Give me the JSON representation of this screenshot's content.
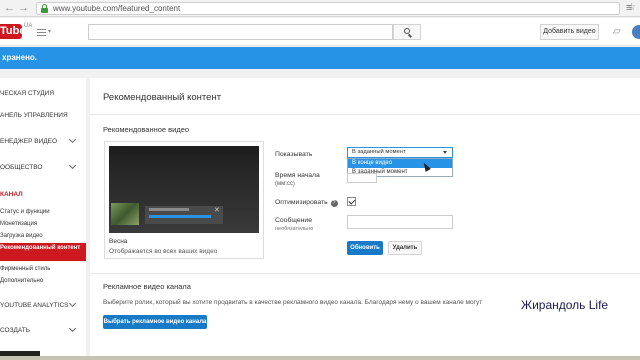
{
  "browser": {
    "url": "www.youtube.com/featured_content",
    "back_arrow": "←",
    "forward_arrow": "→",
    "star_glyph": "☆",
    "menu_glyph": "≡"
  },
  "masthead": {
    "logo_text": "Tube",
    "logo_region": "UA",
    "search_placeholder": "",
    "upload_label": "Добавить видео",
    "bell_glyph": "🔔",
    "brand_color": "#cc181e"
  },
  "banner": {
    "text": "хранено.",
    "color": "#2793e6"
  },
  "sidebar": {
    "items": [
      {
        "label": "ЧЕСКАЯ СТУДИЯ",
        "chevron": false
      },
      {
        "label": "АНЕЛЬ УПРАВЛЕНИЯ",
        "chevron": false
      },
      {
        "label": "ЕНЕДЖЕР ВИДЕО",
        "chevron": true
      },
      {
        "label": "ООБЩЕСТВО",
        "chevron": true
      }
    ],
    "section_label": "КАНАЛ",
    "sub_items": [
      {
        "label": "Статус и функции"
      },
      {
        "label": "Монетизация"
      },
      {
        "label": "Загрузка видео"
      },
      {
        "label": "Рекомендованный контент",
        "active": true
      },
      {
        "label": "Фирменный стиль"
      },
      {
        "label": "Дополнительно"
      }
    ],
    "bottom_items": [
      {
        "label": "YOUTUBE ANALYTICS",
        "chevron": true
      },
      {
        "label": "СОЗДАТЬ",
        "chevron": true
      }
    ]
  },
  "main": {
    "title": "Рекомендованный контент",
    "featured_video": {
      "section_title": "Рекомендованное видео",
      "video_name": "Весна",
      "video_description": "Отображается во всех ваших видео",
      "close_glyph": "✕",
      "fields": {
        "show_label": "Показывать",
        "select_value": "В заданный момент",
        "dropdown_options": [
          "В конце видео",
          "В заданный момент"
        ],
        "highlighted_option": "В конце видео",
        "start_time_label": "Время начала",
        "start_time_sub": "(мм:сс)",
        "optimize_label": "Оптимизировать",
        "optimize_checked": true,
        "help_glyph": "?",
        "message_label": "Сообщение",
        "message_sub": "необязательно"
      },
      "save_label": "Обновить",
      "delete_label": "Удалить"
    },
    "channel_trailer": {
      "section_title": "Рекламное видео канала",
      "description": "Выберите ролик, который вы хотите продвигать в качестве рекламного видео канала. Благодаря нему о вашем канале могут",
      "button_label": "Выбрать рекламное видео канала"
    }
  },
  "watermark": "Жирандоль Life",
  "colors": {
    "accent_blue": "#167ac6",
    "banner_blue": "#2793e6",
    "red": "#cc181e"
  }
}
